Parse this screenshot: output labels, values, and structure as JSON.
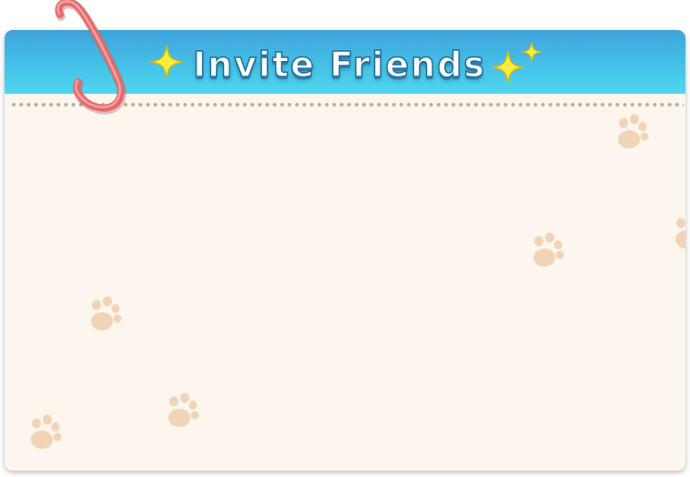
{
  "dialog": {
    "title": "Invite Friends"
  },
  "colors": {
    "header_top": "#3ea3da",
    "header_bottom": "#50d7ee",
    "card_bg": "#fdf6ee",
    "paw": "#f1d4b6",
    "clip": "#e46a6a",
    "sparkle": "#f7ef3a"
  },
  "icons": {
    "left_sparkle": "sparkle-icon",
    "right_sparkle": "sparkle-icon",
    "paperclip": "paperclip-icon",
    "paw": "paw-print-icon"
  }
}
